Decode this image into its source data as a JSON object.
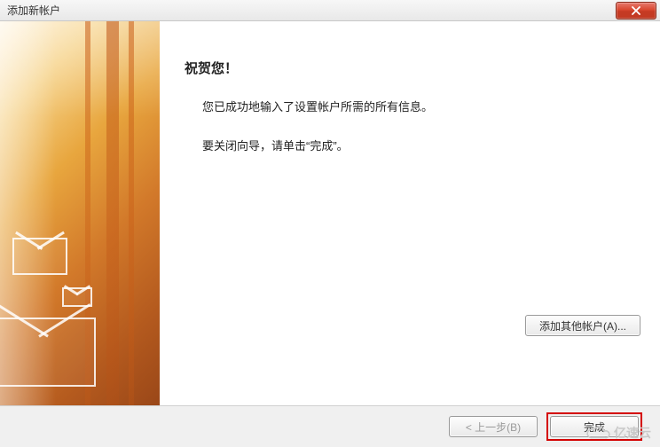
{
  "window": {
    "title": "添加新帐户"
  },
  "body": {
    "heading": "祝贺您！",
    "line1": "您已成功地输入了设置帐户所需的所有信息。",
    "line2": "要关闭向导，请单击“完成”。"
  },
  "buttons": {
    "add_other": "添加其他帐户(A)...",
    "back": "< 上一步(B)",
    "finish": "完成"
  },
  "watermark": {
    "text": "亿速云"
  }
}
